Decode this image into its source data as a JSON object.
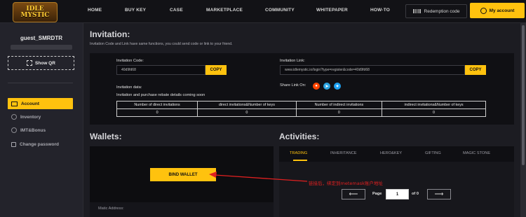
{
  "nav": {
    "logo_line1": "IDLE",
    "logo_line2": "MYSTIC",
    "items": [
      "HOME",
      "BUY KEY",
      "CASE",
      "MARKETPLACE",
      "COMMUNITY",
      "WHITEPAPER",
      "HOW-TO"
    ],
    "redemption": "Redemption code",
    "my_account": "My account"
  },
  "sidebar": {
    "username": "guest_SMRDTR",
    "show_qr": "Show QR",
    "items": [
      {
        "label": "Account",
        "active": true
      },
      {
        "label": "Inventory",
        "active": false
      },
      {
        "label": "IMT&Bonus",
        "active": false
      },
      {
        "label": "Change password",
        "active": false
      }
    ]
  },
  "invitation": {
    "title": "Invitation:",
    "subtitle": "Invitation Code and Link have same functions, you could send code or link to your friend.",
    "code_label": "Invitation Code:",
    "code_value": "40d9fd68",
    "copy": "COPY",
    "link_label": "Invitation Link:",
    "link_value": "www.idlemystic.io/login?type=register&code=40d9fd68",
    "share_label": "Share Link On:",
    "data_label": "Invitation data:",
    "rebate_note": "Invitation and purchase rebate details coming soon",
    "table_headers": [
      "Number of direct invitations",
      "direct invitations&Number of keys",
      "Number of indirect invitations",
      "indirect invitations&Number of keys"
    ],
    "table_values": [
      "0",
      "0",
      "0",
      "0"
    ]
  },
  "wallets": {
    "title": "Wallets:",
    "bind_button": "BIND WALLET",
    "matic_label": "Matic Address:"
  },
  "annotation": {
    "note": "链接后，绑定到metemask账户地址",
    "color": "#e02020"
  },
  "activities": {
    "title": "Activities:",
    "tabs": [
      "TRADING",
      "INHERITANCE",
      "HERO&KEY",
      "GIFTING",
      "MAGIC STONE"
    ],
    "active_tab": "TRADING",
    "page_label": "Page",
    "page_value": "1",
    "page_total": "of 0",
    "prev": "⟵",
    "next": "⟶"
  },
  "colors": {
    "accent": "#ffc20e",
    "background": "#1c1c22"
  }
}
